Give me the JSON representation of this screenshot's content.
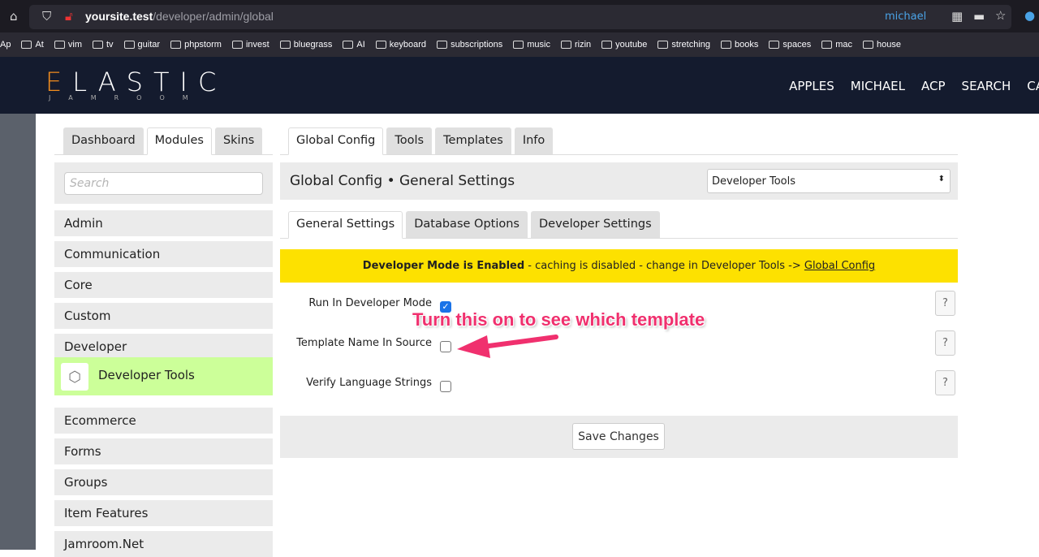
{
  "browser": {
    "url_host": "yoursite.test",
    "url_path": "/developer/admin/global",
    "profile": "michael",
    "bookmarks": [
      "At",
      "vim",
      "tv",
      "guitar",
      "phpstorm",
      "invest",
      "bluegrass",
      "AI",
      "keyboard",
      "subscriptions",
      "music",
      "rizin",
      "youtube",
      "stretching",
      "books",
      "spaces",
      "mac",
      "house"
    ],
    "bookmark_prefix": "Ap"
  },
  "header": {
    "logo": "ELASTIC",
    "logo_sub": "JAMROOM",
    "nav": [
      "APPLES",
      "MICHAEL",
      "ACP",
      "SEARCH",
      "CA"
    ]
  },
  "sidebar": {
    "tabs": [
      "Dashboard",
      "Modules",
      "Skins"
    ],
    "active_tab": "Modules",
    "search_placeholder": "Search",
    "modules": [
      "Admin",
      "Communication",
      "Core",
      "Custom",
      "Developer",
      "Developer Tools",
      "Ecommerce",
      "Forms",
      "Groups",
      "Item Features",
      "Jamroom.Net"
    ],
    "active_module": "Developer Tools"
  },
  "main": {
    "tabs": [
      "Global Config",
      "Tools",
      "Templates",
      "Info"
    ],
    "active_tab": "Global Config",
    "title": "Global Config • General Settings",
    "module_select": "Developer Tools",
    "subtabs": [
      "General Settings",
      "Database Options",
      "Developer Settings"
    ],
    "active_subtab": "General Settings",
    "notice": {
      "bold": "Developer Mode is Enabled",
      "text": " - caching is disabled - change in Developer Tools -> ",
      "link": "Global Config"
    },
    "settings": [
      {
        "label": "Run In Developer Mode",
        "checked": true
      },
      {
        "label": "Template Name In Source",
        "checked": false
      },
      {
        "label": "Verify Language Strings",
        "checked": false
      }
    ],
    "help_label": "?",
    "save_label": "Save Changes"
  },
  "annotation": {
    "text": "Turn this on to see which template",
    "color": "#f0306e"
  }
}
